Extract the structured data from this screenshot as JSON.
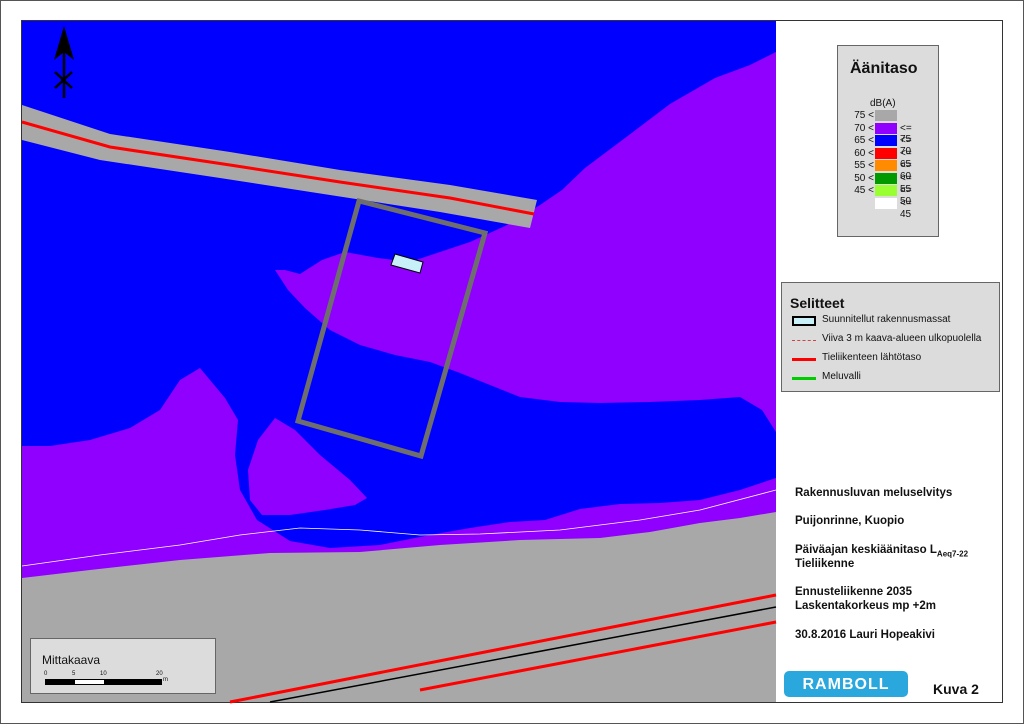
{
  "noise_legend": {
    "title": "Äänitaso",
    "unit": "dB(A)",
    "classes": [
      {
        "lower": "75 <",
        "upper": "",
        "color": "#a8a8a8"
      },
      {
        "lower": "70 <",
        "upper": "<= 75",
        "color": "#8f00ff"
      },
      {
        "lower": "65 <",
        "upper": "<= 70",
        "color": "#0000ff"
      },
      {
        "lower": "60 <",
        "upper": "<= 65",
        "color": "#ff0000"
      },
      {
        "lower": "55 <",
        "upper": "<= 60",
        "color": "#ff8c00"
      },
      {
        "lower": "50 <",
        "upper": "<= 55",
        "color": "#009900"
      },
      {
        "lower": "45 <",
        "upper": "<= 50",
        "color": "#99ff33"
      },
      {
        "lower": "",
        "upper": "<= 45",
        "color": "#ffffff"
      }
    ]
  },
  "key_legend": {
    "title": "Selitteet",
    "items": [
      {
        "label": "Suunnitellut rakennusmassat",
        "symbol": "building-box-icon"
      },
      {
        "label": "Viiva 3 m kaava-alueen ulkopuolella",
        "symbol": "dashed-line-icon"
      },
      {
        "label": "Tieliikenteen lähtötaso",
        "symbol": "red-line-icon"
      },
      {
        "label": "Meluvalli",
        "symbol": "green-line-icon"
      }
    ]
  },
  "info": {
    "report": "Rakennusluvan meluselvitys",
    "location": "Puijonrinne, Kuopio",
    "metric_prefix": "Päiväajan keskiäänitaso L",
    "metric_subscript": "Aeq7-22",
    "source": "Tieliikenne",
    "forecast": "Ennusteliikenne 2035",
    "height": "Laskentakorkeus mp +2m",
    "date_author": "30.8.2016 Lauri Hopeakivi"
  },
  "scale": {
    "title": "Mittakaava",
    "ticks": [
      "0",
      "5",
      "10",
      "20"
    ],
    "unit": "m"
  },
  "logo_text": "RAMBOLL",
  "figure_label": "Kuva 2",
  "colors": {
    "zone_70_75": "#8f00ff",
    "zone_65_70": "#0000ff",
    "road_surface": "#a8a8a8",
    "road_line": "#ff0000",
    "plan_area_outline": "#6e6e6e",
    "building": "#c8f0f8"
  }
}
